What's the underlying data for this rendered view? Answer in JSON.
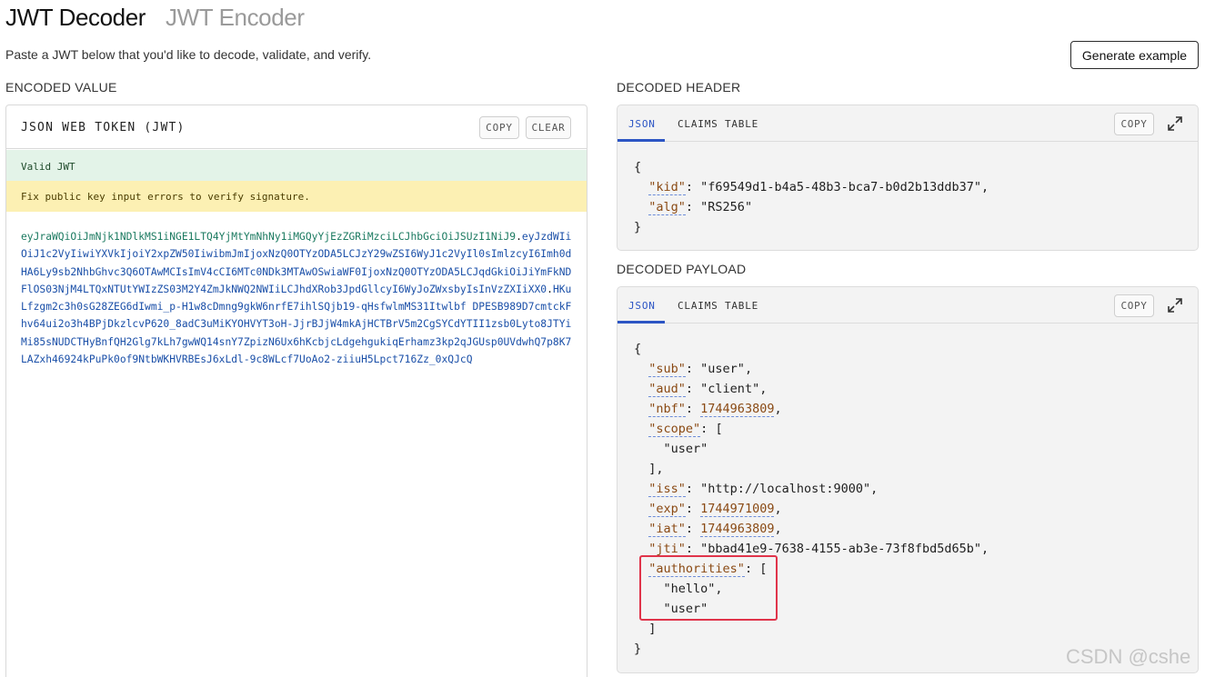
{
  "tabs": {
    "decoder": "JWT Decoder",
    "encoder": "JWT Encoder"
  },
  "subtitle": "Paste a JWT below that you'd like to decode, validate, and verify.",
  "generate_button": "Generate example",
  "encoded": {
    "section_label": "ENCODED VALUE",
    "panel_title": "JSON WEB TOKEN (JWT)",
    "copy_label": "COPY",
    "clear_label": "CLEAR",
    "status_valid": "Valid JWT",
    "status_warning": "Fix public key input errors to verify signature.",
    "token_header": "eyJraWQiOiJmNjk1NDlkMS1iNGE1LTQ4YjMtYmNhNy1iMGQyYjEzZGRiMzciLCJhbGciOiJSUzI1NiJ9",
    "token_payload": "eyJzdWIiOiJ1c2VyIiwiYXVkIjoiY2xpZW50IiwibmJmIjoxNzQ0OTYzODA5LCJzY29wZSI6WyJ1c2VyIl0sImlzcyI6Imh0dHA6Ly9sb2NhbGhvc3Q6OTAwMCIsImV4cCI6MTc0NDk3MTAwOSwiaWF0IjoxNzQ0OTYzODA5LCJqdGkiOiJiYmFkNDFlOS03NjM4LTQxNTUtYWIzZS03M2Y4ZmJkNWQ2NWIiLCJhdXRob3JpdGllcyI6WyJoZWxsbyIsInVzZXIiXX0",
    "token_signature": "HKuLfzgm2c3h0sG28ZEG6dIwmi_p-H1w8cDmng9gkW6nrfE7ihlSQjb19-qHsfwlmMS31Itwlbf DPESB989D7cmtckFhv64ui2o3h4BPjDkzlcvP620_8adC3uMiKYOHVYT3oH-JjrBJjW4mkAjHCTBrV5m2CgSYCdYTII1zsb0Lyto8JTYiMi85sNUDCTHyBnfQH2Glg7kLh7gwWQ14snY7ZpizN6Ux6hKcbjcLdgehgukiqErhamz3kp2qJGUsp0UVdwhQ7p8K7LAZxh46924kPuPk0of9NtbWKHVRBEsJ6xLdl-9c8WLcf7UoAo2-ziiuH5Lpct716Zz_0xQJcQ"
  },
  "decoded_header": {
    "section_label": "DECODED HEADER",
    "tab_json": "JSON",
    "tab_claims": "CLAIMS TABLE",
    "copy_label": "COPY",
    "lines": [
      {
        "indent": "",
        "key": "",
        "value": "",
        "text": "{",
        "vtype": "punct"
      },
      {
        "indent": "  ",
        "key": "\"kid\"",
        "value": "\"f69549d1-b4a5-48b3-bca7-b0d2b13ddb37\"",
        "text": ",",
        "vtype": "str"
      },
      {
        "indent": "  ",
        "key": "\"alg\"",
        "value": "\"RS256\"",
        "text": "",
        "vtype": "str"
      },
      {
        "indent": "",
        "key": "",
        "value": "",
        "text": "}",
        "vtype": "punct"
      }
    ]
  },
  "decoded_payload": {
    "section_label": "DECODED PAYLOAD",
    "tab_json": "JSON",
    "tab_claims": "CLAIMS TABLE",
    "copy_label": "COPY",
    "lines": [
      {
        "indent": "",
        "key": "",
        "value": "",
        "text": "{",
        "vtype": "punct"
      },
      {
        "indent": "  ",
        "key": "\"sub\"",
        "value": "\"user\"",
        "text": ",",
        "vtype": "str"
      },
      {
        "indent": "  ",
        "key": "\"aud\"",
        "value": "\"client\"",
        "text": ",",
        "vtype": "str"
      },
      {
        "indent": "  ",
        "key": "\"nbf\"",
        "value": "1744963809",
        "text": ",",
        "vtype": "num"
      },
      {
        "indent": "  ",
        "key": "\"scope\"",
        "value": "[",
        "text": "",
        "vtype": "punct"
      },
      {
        "indent": "    ",
        "key": "",
        "value": "\"user\"",
        "text": "",
        "vtype": "str"
      },
      {
        "indent": "  ",
        "key": "",
        "value": "",
        "text": "],",
        "vtype": "punct"
      },
      {
        "indent": "  ",
        "key": "\"iss\"",
        "value": "\"http://localhost:9000\"",
        "text": ",",
        "vtype": "str"
      },
      {
        "indent": "  ",
        "key": "\"exp\"",
        "value": "1744971009",
        "text": ",",
        "vtype": "num"
      },
      {
        "indent": "  ",
        "key": "\"iat\"",
        "value": "1744963809",
        "text": ",",
        "vtype": "num"
      },
      {
        "indent": "  ",
        "key": "\"jti\"",
        "value": "\"bbad41e9-7638-4155-ab3e-73f8fbd5d65b\"",
        "text": ",",
        "vtype": "str"
      },
      {
        "indent": "  ",
        "key": "\"authorities\"",
        "value": "[",
        "text": "",
        "vtype": "punct"
      },
      {
        "indent": "    ",
        "key": "",
        "value": "\"hello\"",
        "text": ",",
        "vtype": "str"
      },
      {
        "indent": "    ",
        "key": "",
        "value": "\"user\"",
        "text": "",
        "vtype": "str"
      },
      {
        "indent": "  ",
        "key": "",
        "value": "",
        "text": "]",
        "vtype": "punct"
      },
      {
        "indent": "",
        "key": "",
        "value": "",
        "text": "}",
        "vtype": "punct"
      }
    ]
  },
  "icons": {
    "expand": "expand-icon"
  },
  "colors": {
    "accent": "#2c55c4",
    "valid_bg": "#e3f3e8",
    "warning_bg": "#fcf0b3",
    "highlight": "#e0344a"
  },
  "watermark": "CSDN @cshe"
}
